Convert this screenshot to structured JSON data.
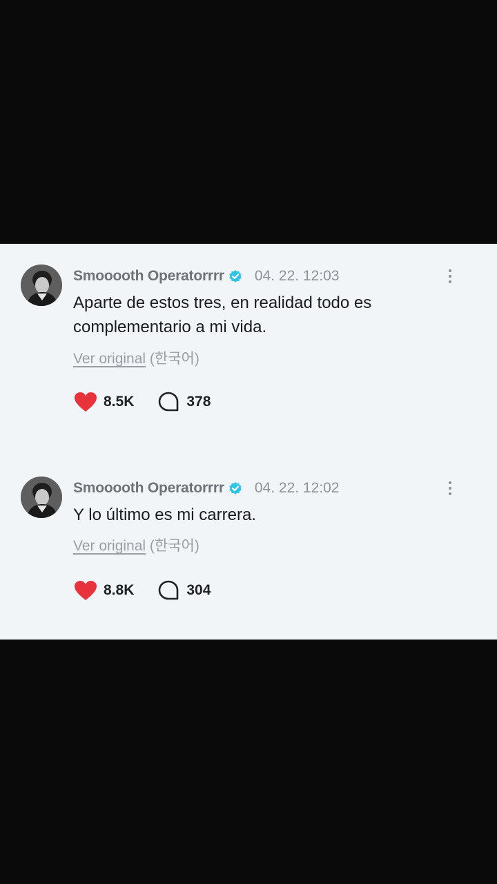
{
  "posts": [
    {
      "username": "Smooooth Operatorrrr",
      "timestamp": "04. 22. 12:03",
      "text": "Aparte de estos tres, en realidad todo es complementario a mi vida.",
      "translate_link": "Ver original",
      "translate_lang": "(한국어)",
      "likes": "8.5K",
      "comments": "378"
    },
    {
      "username": "Smooooth Operatorrrr",
      "timestamp": "04. 22. 12:02",
      "text": "Y lo último es mi carrera.",
      "translate_link": "Ver original",
      "translate_lang": "(한국어)",
      "likes": "8.8K",
      "comments": "304"
    }
  ],
  "colors": {
    "background": "#f2f5f7",
    "verified_badge": "#2ec4e6",
    "heart": "#e8323c",
    "letterbox": "#0a0a0a"
  },
  "icons": {
    "verified": "verified-badge-icon",
    "more": "more-vertical-icon",
    "like": "heart-icon",
    "comment": "comment-bubble-icon"
  }
}
